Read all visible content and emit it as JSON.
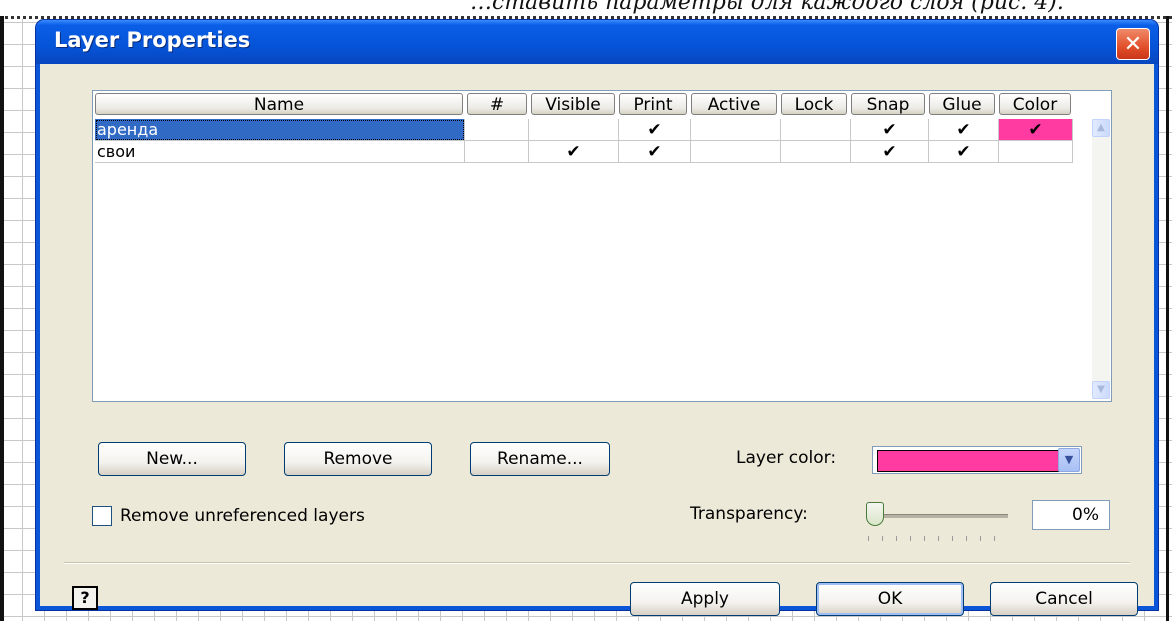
{
  "document": {
    "caption_fragment": "…ставить параметры для каждого слоя (рис. 4)."
  },
  "dialog": {
    "title": "Layer Properties",
    "close_glyph": "✕"
  },
  "table": {
    "columns": [
      "Name",
      "#",
      "Visible",
      "Print",
      "Active",
      "Lock",
      "Snap",
      "Glue",
      "Color"
    ],
    "rows": [
      {
        "name": "аренда",
        "num": "",
        "visible": "",
        "print": "✔",
        "active": "",
        "lock": "",
        "snap": "✔",
        "glue": "✔",
        "color": "✔",
        "selected": true
      },
      {
        "name": "свои",
        "num": "",
        "visible": "✔",
        "print": "✔",
        "active": "",
        "lock": "",
        "snap": "✔",
        "glue": "✔",
        "color": "",
        "selected": false
      }
    ],
    "color_cell_fill": "#ff3aa0"
  },
  "buttons": {
    "new": "New...",
    "remove": "Remove",
    "rename": "Rename...",
    "apply": "Apply",
    "ok": "OK",
    "cancel": "Cancel",
    "help": "?"
  },
  "layer_color": {
    "label": "Layer color:",
    "value": "#ff3aa0"
  },
  "remove_unreferenced": {
    "label": "Remove unreferenced layers",
    "checked": false
  },
  "transparency": {
    "label": "Transparency:",
    "value": "0%",
    "level": 0
  },
  "colors": {
    "title_bar": "#0554d8",
    "dialog_face": "#ece9d8",
    "selection": "#316ac5",
    "close_button": "#e2502a"
  }
}
